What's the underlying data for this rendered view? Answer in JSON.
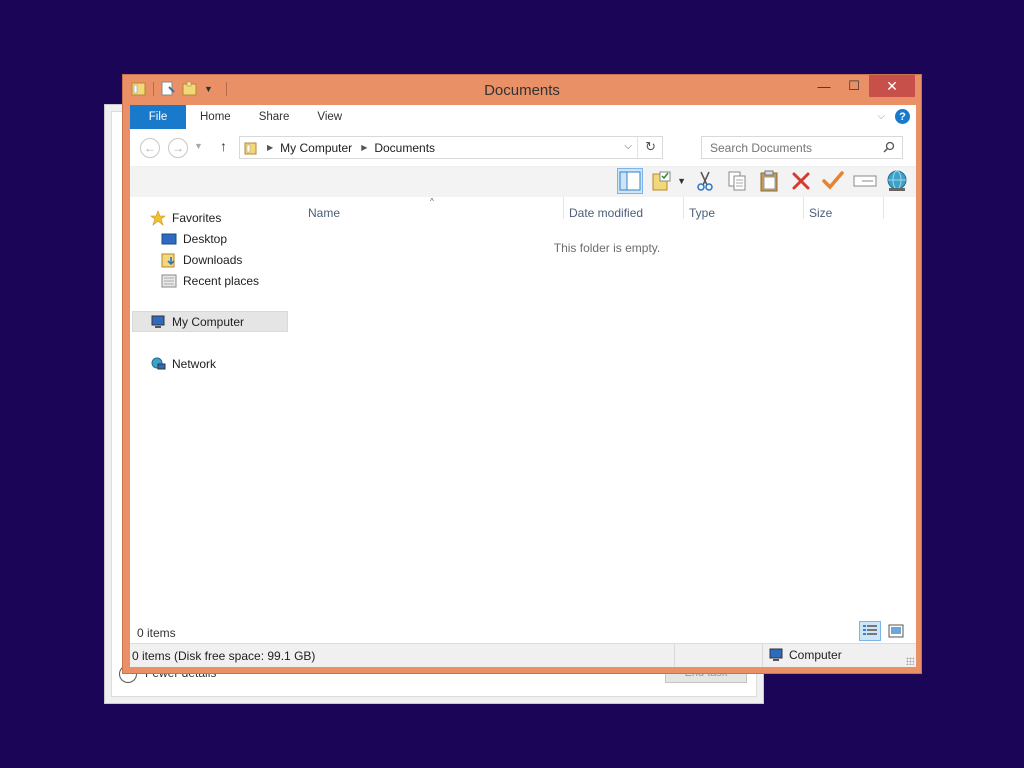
{
  "background_window": {
    "footer_text": "Fewer details",
    "end_task_label": "End task"
  },
  "window": {
    "title": "Documents",
    "controls": {
      "minimize": "—",
      "maximize": "☐",
      "close": "✕"
    }
  },
  "ribbon": {
    "tabs": [
      {
        "label": "File"
      },
      {
        "label": "Home"
      },
      {
        "label": "Share"
      },
      {
        "label": "View"
      }
    ]
  },
  "address_bar": {
    "breadcrumbs": [
      "My Computer",
      "Documents"
    ],
    "refresh_icon": "refresh-icon"
  },
  "search": {
    "placeholder": "Search Documents"
  },
  "navigation_pane": {
    "favorites_label": "Favorites",
    "favorites": [
      {
        "label": "Desktop",
        "icon": "desktop-icon"
      },
      {
        "label": "Downloads",
        "icon": "downloads-icon"
      },
      {
        "label": "Recent places",
        "icon": "recent-places-icon"
      }
    ],
    "computer_label": "My Computer",
    "network_label": "Network"
  },
  "file_list": {
    "columns": [
      "Name",
      "Date modified",
      "Type",
      "Size"
    ],
    "empty_message": "This folder is empty."
  },
  "footer": {
    "items_count": "0 items"
  },
  "status_bar": {
    "left_text": "0 items (Disk free space: 99.1 GB)",
    "right_text": "Computer"
  },
  "colors": {
    "desktop_background": "#1b0556",
    "window_frame": "#e99067",
    "file_tab": "#1979ca",
    "close_button": "#c7504a"
  }
}
